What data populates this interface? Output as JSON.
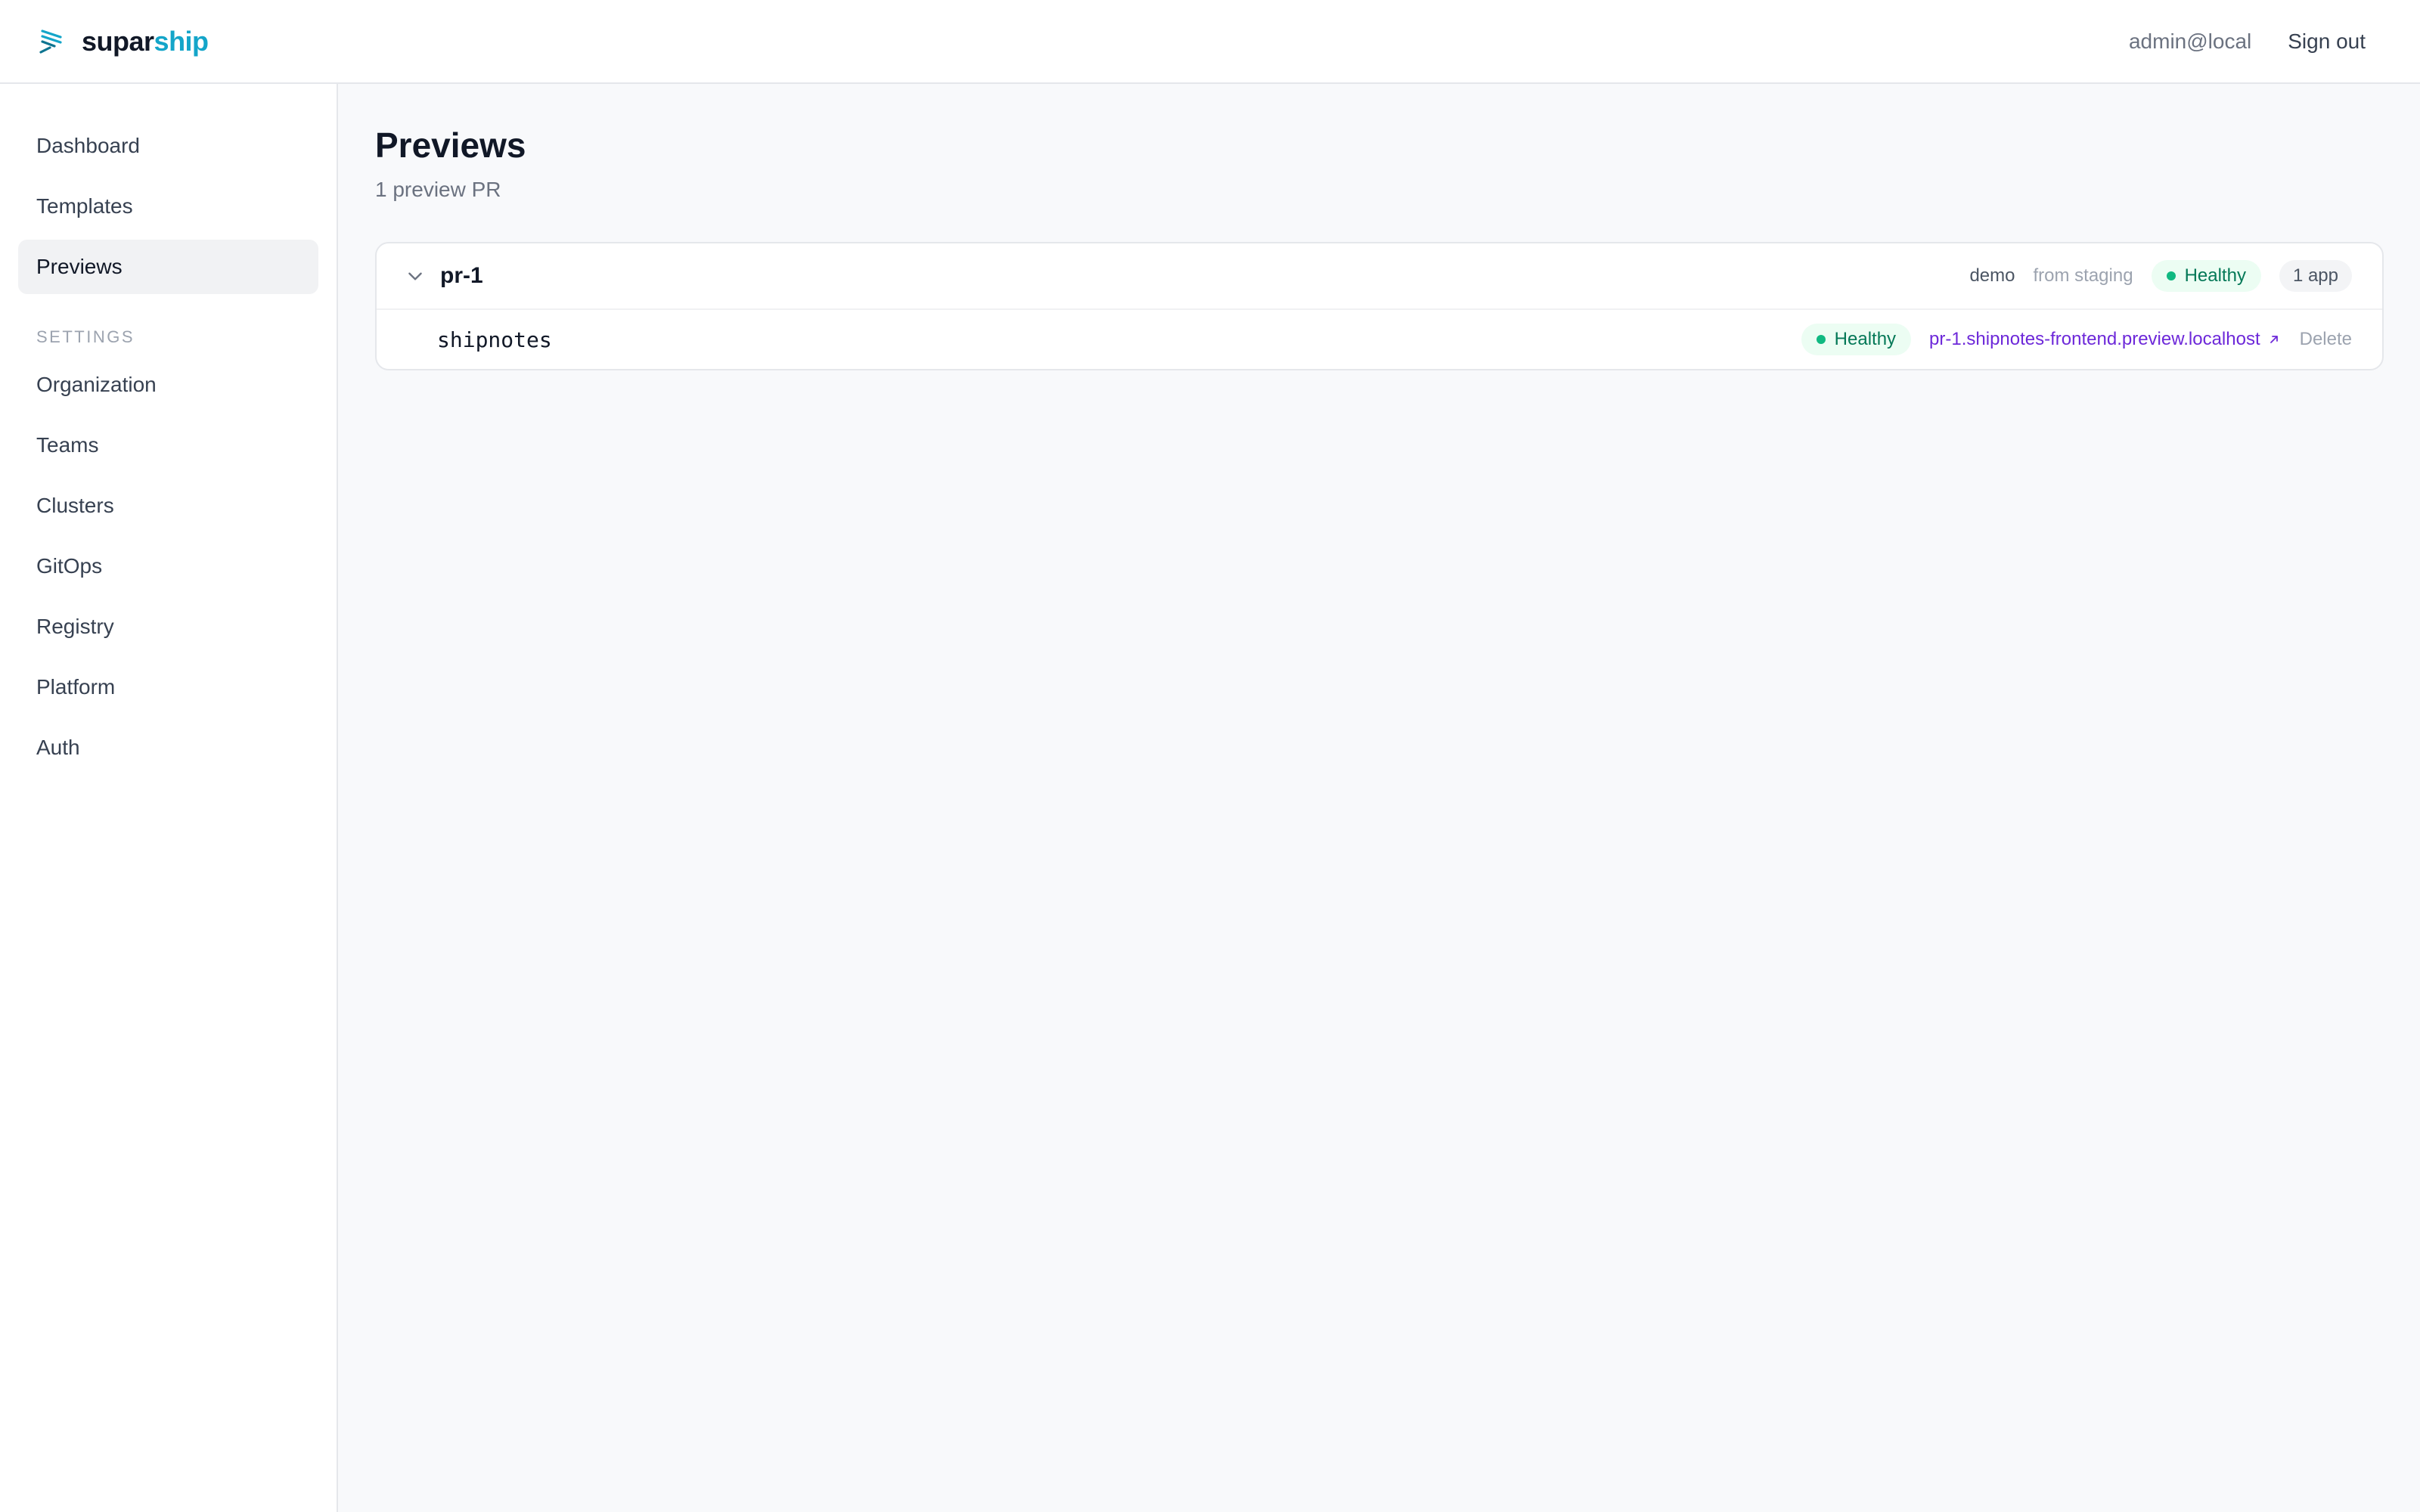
{
  "header": {
    "brand_part1": "supar",
    "brand_part2": "ship",
    "brand_color": "#14a5c9",
    "logo_icon": "suparship-logo-icon",
    "user": "admin@local",
    "signout_label": "Sign out"
  },
  "sidebar": {
    "items": [
      {
        "label": "Dashboard"
      },
      {
        "label": "Templates"
      },
      {
        "label": "Previews",
        "active": true
      }
    ],
    "settings_heading": "SETTINGS",
    "settings_items": [
      {
        "label": "Organization"
      },
      {
        "label": "Teams"
      },
      {
        "label": "Clusters"
      },
      {
        "label": "GitOps"
      },
      {
        "label": "Registry"
      },
      {
        "label": "Platform"
      },
      {
        "label": "Auth"
      }
    ]
  },
  "main": {
    "title": "Previews",
    "subtitle": "1 preview PR",
    "previews": [
      {
        "name": "pr-1",
        "expand_icon": "chevron-down-icon",
        "team": "demo",
        "source": "from staging",
        "status": "Healthy",
        "status_color": "#10b981",
        "app_count": "1 app",
        "apps": [
          {
            "name": "shipnotes",
            "status": "Healthy",
            "url": "pr-1.shipnotes-frontend.preview.localhost",
            "url_icon": "external-link-icon",
            "delete_label": "Delete"
          }
        ]
      }
    ]
  }
}
